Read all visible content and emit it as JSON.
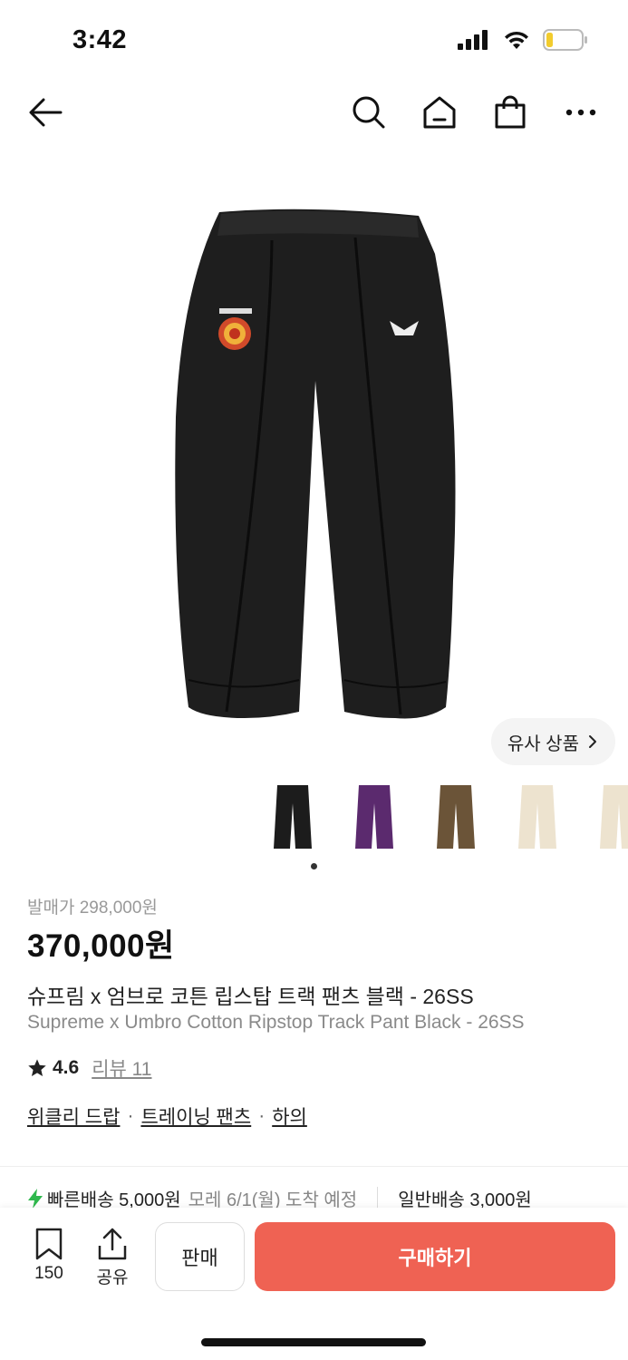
{
  "status": {
    "time": "3:42"
  },
  "nav": {
    "back_icon": "arrow-left-icon",
    "search_icon": "search-icon",
    "home_icon": "home-icon",
    "bag_icon": "shopping-bag-icon",
    "more_icon": "more-icon"
  },
  "similar": {
    "label": "유사 상품"
  },
  "product": {
    "release_price": "발매가 298,000원",
    "price": "370,000원",
    "title_ko": "슈프림 x 엄브로 코튼 립스탑 트랙 팬츠 블랙 - 26SS",
    "title_en": "Supreme x Umbro Cotton Ripstop Track Pant Black - 26SS",
    "rating": "4.6",
    "review": "리뷰 11",
    "tags": [
      "위클리 드랍",
      "트레이닝 팬츠",
      "하의"
    ],
    "thumb_colors": [
      "#1c1c1c",
      "#5b2a6e",
      "#6b5438",
      "#ede3cf",
      "#ede3cf"
    ]
  },
  "shipping": {
    "fast_label": "빠른배송 5,000원",
    "fast_eta": "모레 6/1(월) 도착 예정",
    "normal_label": "일반배송 3,000원"
  },
  "bottom": {
    "save_count": "150",
    "share_label": "공유",
    "sell_label": "판매",
    "buy_label": "구매하기"
  },
  "colors": {
    "accent": "#ef6253",
    "fast_icon": "#2fb84d"
  }
}
